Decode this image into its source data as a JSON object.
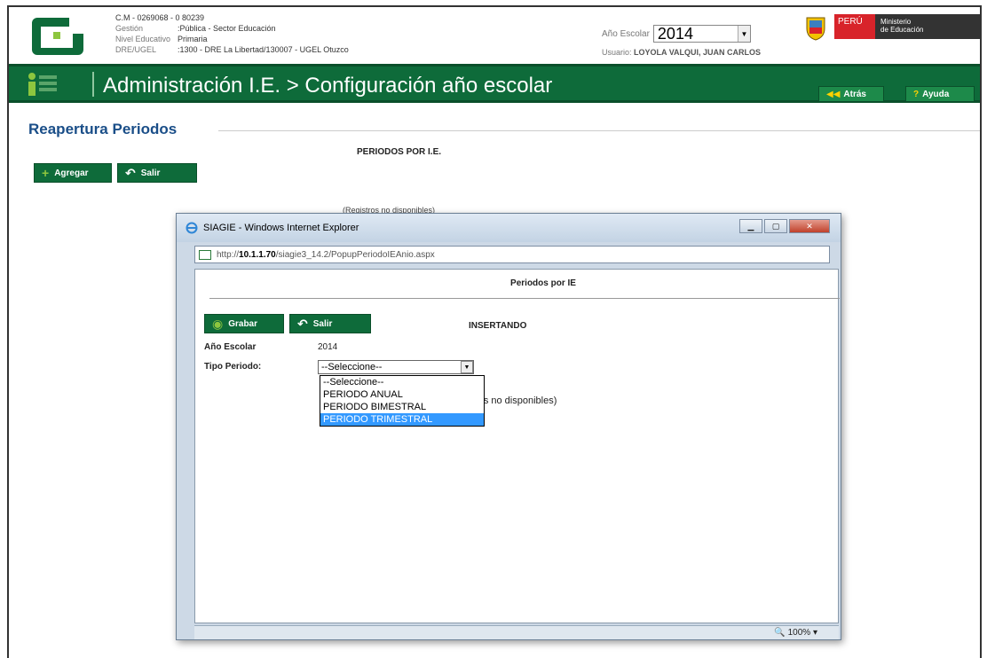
{
  "header": {
    "cm": "C.M - 0269068 - 0  80239",
    "rows": [
      {
        "label": "Gestión",
        "value": ":Pública - Sector Educación"
      },
      {
        "label": "Nivel Educativo",
        "value": "Primaria"
      },
      {
        "label": "DRE/UGEL",
        "value": ":1300 - DRE La Libertad/130007 - UGEL Otuzco"
      }
    ],
    "anio_label": "Año Escolar",
    "anio_value": "2014",
    "usuario_label": "Usuario:",
    "usuario_value": "LOYOLA VALQUI, JUAN CARLOS",
    "peru": "PERÚ",
    "ministerio_line1": "Ministerio",
    "ministerio_line2": "de Educación"
  },
  "nav": {
    "title": "Administración I.E. > Configuración año escolar",
    "atras_label": "Atrás",
    "ayuda_label": "Ayuda"
  },
  "page": {
    "section_title": "Reapertura Periodos",
    "periodos_header": "PERIODOS POR I.E.",
    "agregar_label": "Agregar",
    "salir_label": "Salir",
    "registros": "(Registros no disponibles)"
  },
  "popup": {
    "window_title": "SIAGIE - Windows Internet Explorer",
    "url_prefix": "http://",
    "url_host": "10.1.1.70",
    "url_path": "/siagie3_14.2/PopupPeriodoIEAnio.aspx",
    "content_title": "Periodos por IE",
    "grabar_label": "Grabar",
    "salir_label": "Salir",
    "status": "INSERTANDO",
    "anio_label": "Año Escolar",
    "anio_value": "2014",
    "tipo_label": "Tipo Periodo:",
    "tipo_selected": "--Seleccione--",
    "options": [
      "--Seleccione--",
      "PERIODO ANUAL",
      "PERIODO BIMESTRAL",
      "PERIODO TRIMESTRAL"
    ],
    "highlighted_option": "PERIODO TRIMESTRAL",
    "registros_partial": "tros no disponibles)",
    "zoom": "100%"
  },
  "colors": {
    "brand_green": "#0e6b3a",
    "title_blue": "#1a4e88",
    "peru_red": "#d8232a",
    "highlight": "#3399ff"
  }
}
